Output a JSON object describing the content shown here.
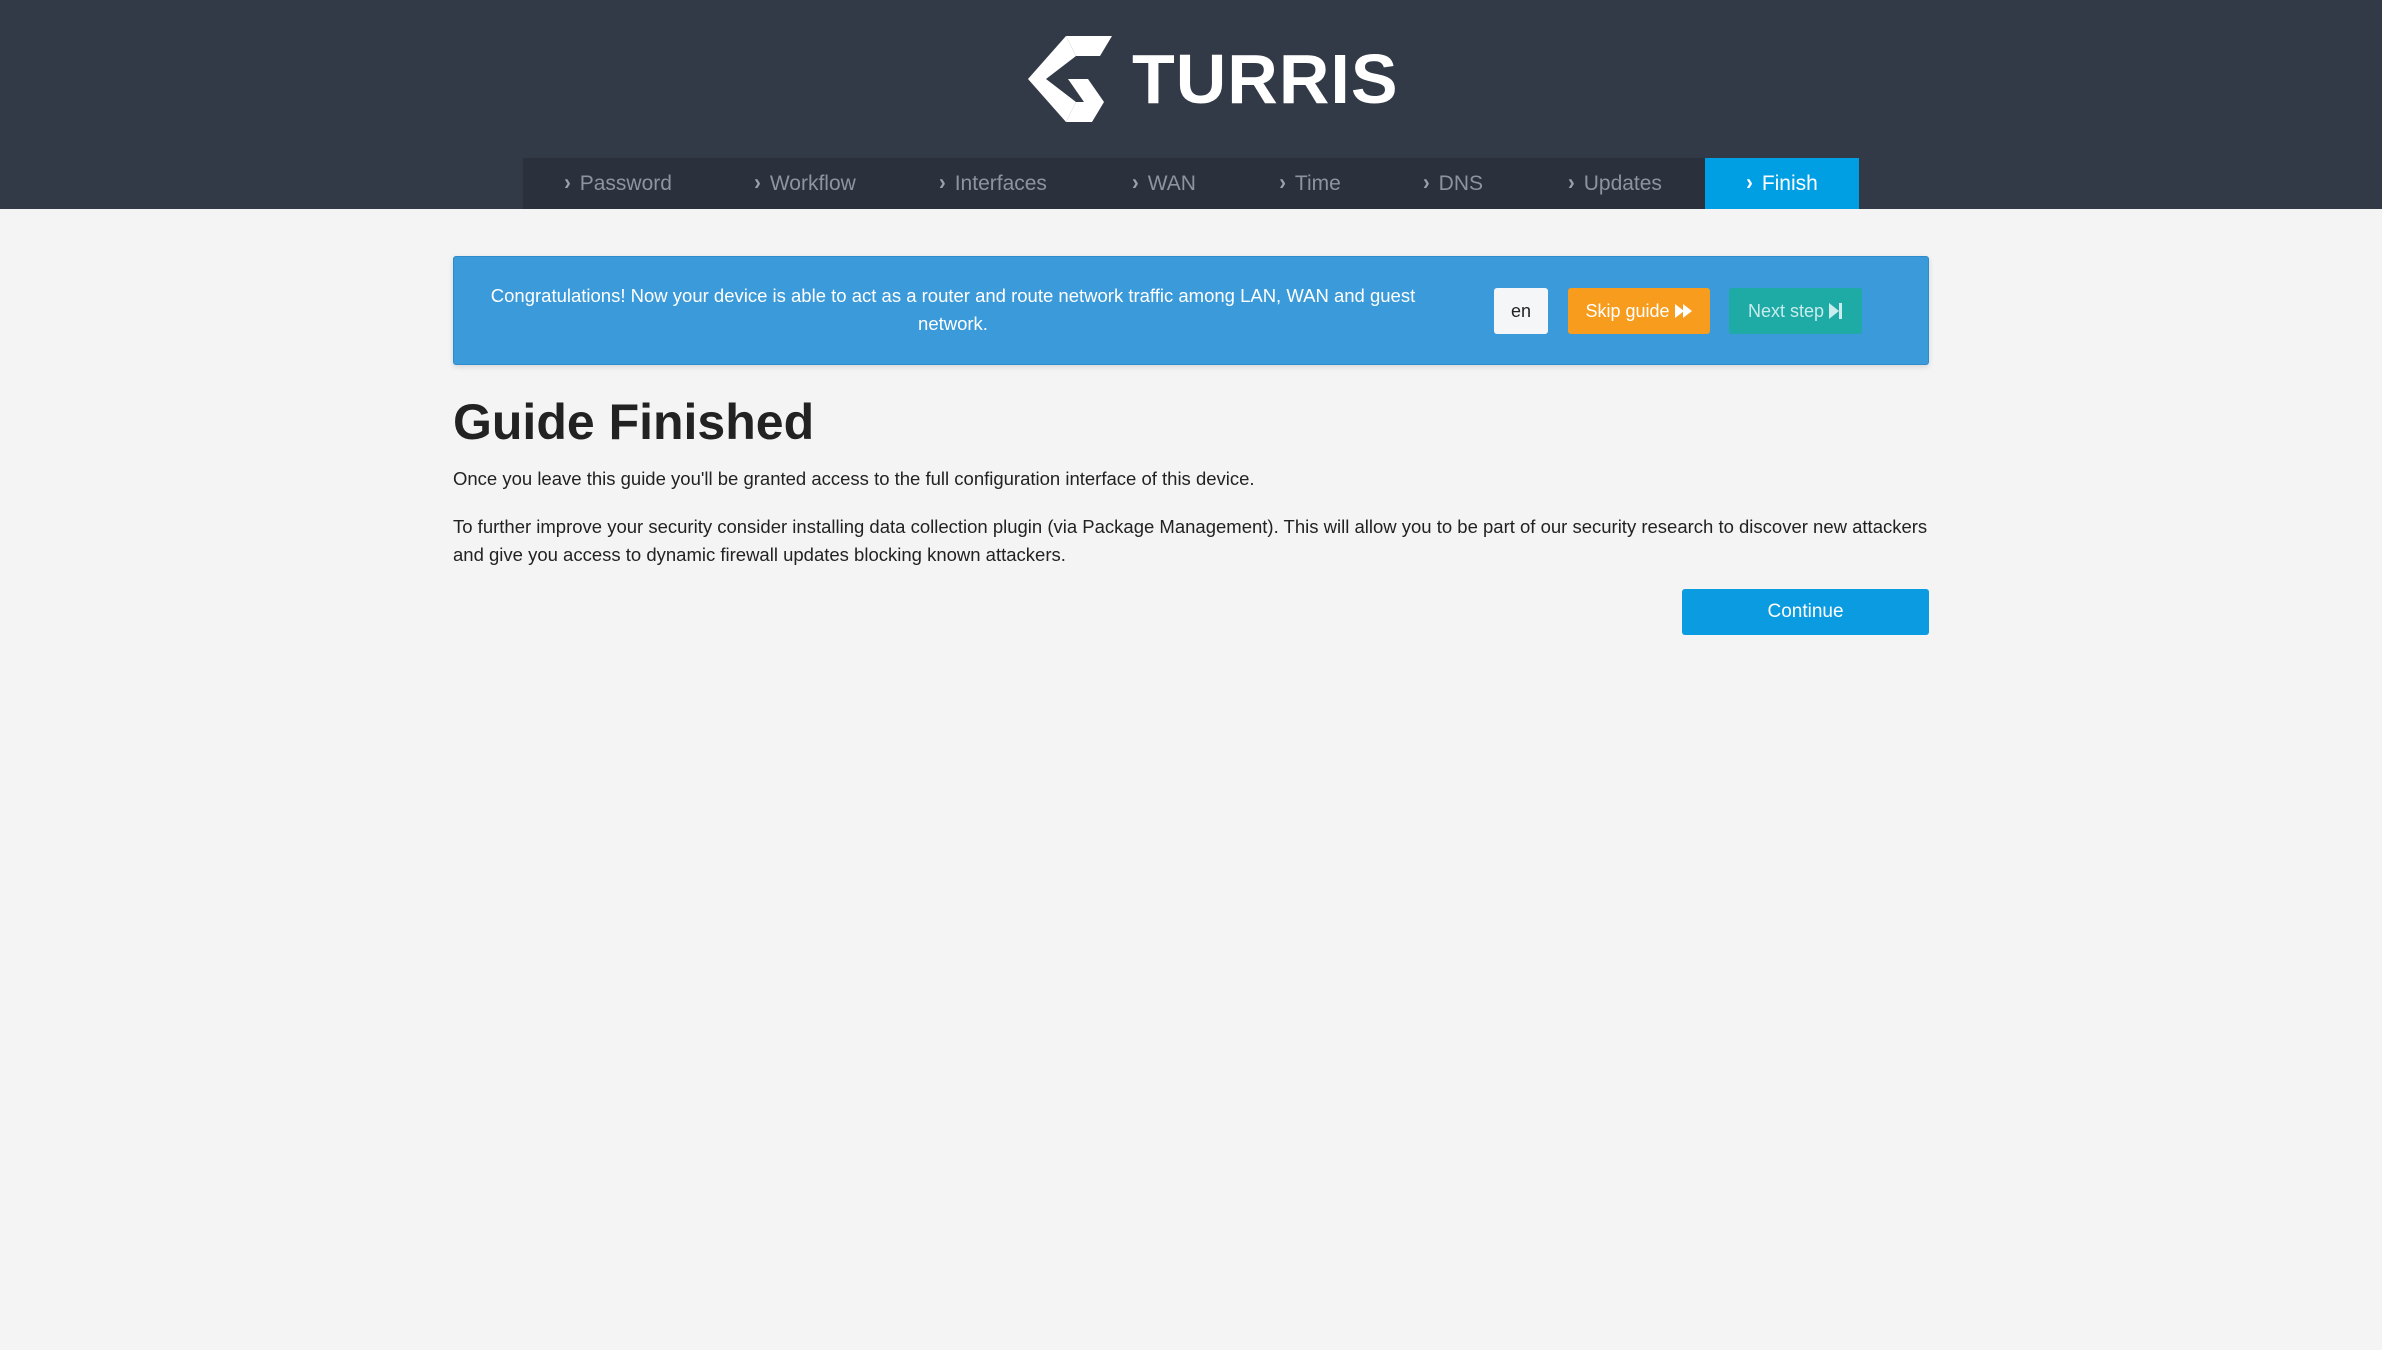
{
  "header": {
    "logo_text": "TURRIS",
    "logo_icon": "turris-logo-icon"
  },
  "nav": {
    "tabs": [
      {
        "label": "Password",
        "active": false
      },
      {
        "label": "Workflow",
        "active": false
      },
      {
        "label": "Interfaces",
        "active": false
      },
      {
        "label": "WAN",
        "active": false
      },
      {
        "label": "Time",
        "active": false
      },
      {
        "label": "DNS",
        "active": false
      },
      {
        "label": "Updates",
        "active": false
      },
      {
        "label": "Finish",
        "active": true
      }
    ],
    "chevron_icon": "chevron-right-icon"
  },
  "banner": {
    "message": "Congratulations! Now your device is able to act as a router and route network traffic among LAN, WAN and guest network.",
    "lang_label": "en",
    "skip_label": "Skip guide",
    "skip_icon": "fast-forward-icon",
    "next_label": "Next step",
    "next_icon": "step-forward-icon"
  },
  "main": {
    "title": "Guide Finished",
    "paragraph1": "Once you leave this guide you'll be granted access to the full configuration interface of this device.",
    "paragraph2": "To further improve your security consider installing data collection plugin (via Package Management). This will allow you to be part of our security research to discover new attackers and give you access to dynamic firewall updates blocking known attackers.",
    "continue_label": "Continue"
  },
  "colors": {
    "header_bg": "#323a47",
    "nav_bg": "#2a313c",
    "active_tab": "#009fe3",
    "banner_bg": "#3b9ad9",
    "skip_button": "#f79c1d",
    "next_button": "#1eaaa5",
    "continue_button": "#0a9be1",
    "page_bg": "#f4f4f5"
  }
}
